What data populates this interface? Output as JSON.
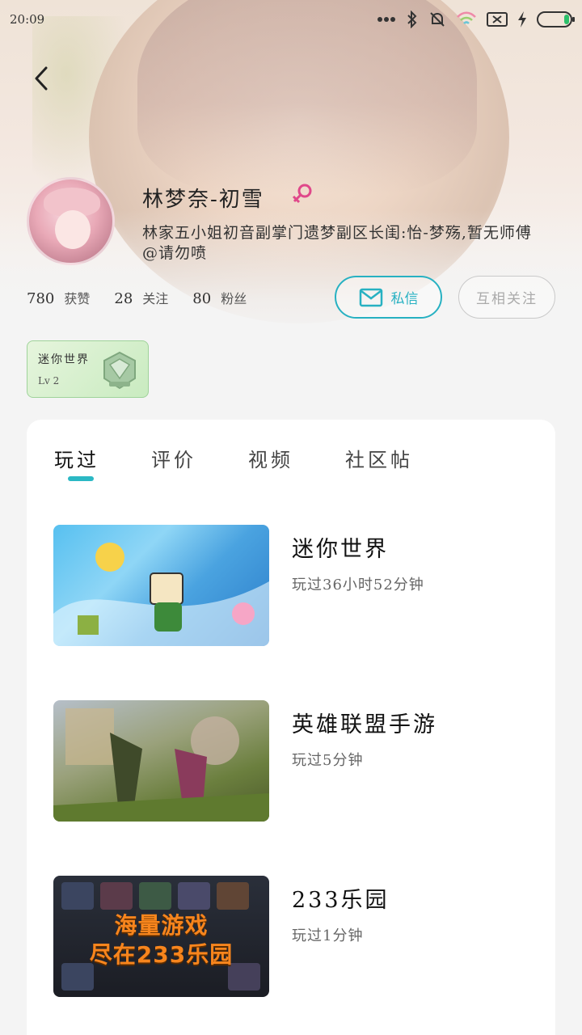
{
  "status_bar": {
    "time": "20:09"
  },
  "profile": {
    "name": "林梦奈-初雪",
    "bio": "林家五小姐初音副掌门遗梦副区长闺:怡-梦殇,暂无师傅@请勿喷",
    "stats": [
      {
        "num": "780",
        "label": "获赞"
      },
      {
        "num": "28",
        "label": "关注"
      },
      {
        "num": "80",
        "label": "粉丝"
      }
    ],
    "message_button": "私信",
    "follow_button": "互相关注",
    "badge": {
      "title": "迷你世界",
      "level": "Lv 2"
    }
  },
  "tabs": [
    "玩过",
    "评价",
    "视频",
    "社区帖"
  ],
  "games": [
    {
      "title": "迷你世界",
      "played": "玩过36小时52分钟"
    },
    {
      "title": "英雄联盟手游",
      "played": "玩过5分钟"
    },
    {
      "title": "233乐园",
      "played": "玩过1分钟",
      "banner_line1": "海量游戏",
      "banner_line2": "尽在233乐园"
    }
  ],
  "colors": {
    "accent": "#2bb8c4",
    "female": "#e0488a"
  }
}
